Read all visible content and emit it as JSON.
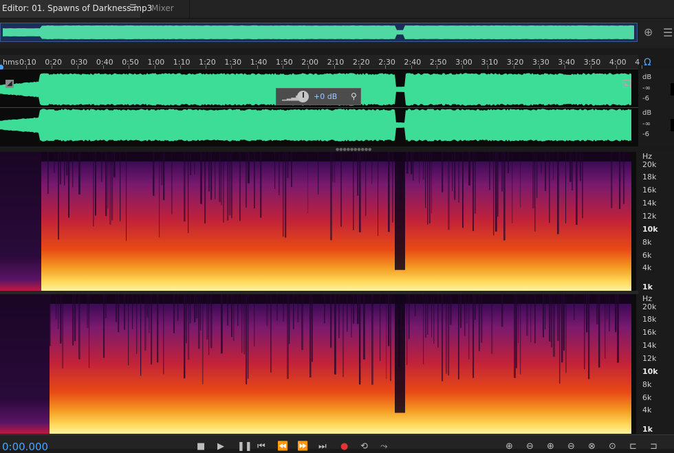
{
  "tabs": {
    "editor_label": "Editor: 01. Spawns of Darkness.mp3",
    "editor_menu_icon": "hamburger-icon",
    "mixer_label": "Mixer"
  },
  "ruler": {
    "unit_label": "hms",
    "ticks": [
      "0:10",
      "0:20",
      "0:30",
      "0:40",
      "0:50",
      "1:00",
      "1:10",
      "1:20",
      "1:30",
      "1:40",
      "1:50",
      "2:00",
      "2:10",
      "2:20",
      "2:30",
      "2:40",
      "2:50",
      "3:00",
      "3:10",
      "3:20",
      "3:30",
      "3:40",
      "3:50",
      "4:00",
      "4"
    ]
  },
  "waveform": {
    "db_unit": "dB",
    "db_inf": "-∞",
    "db_minus6": "-6",
    "wave_color": "#3ddc97"
  },
  "hud": {
    "gain_value": "+0 dB",
    "pin_icon": "pin-icon",
    "knob_icon": "volume-knob-icon"
  },
  "spectral": {
    "unit": "Hz",
    "labels": [
      "20k",
      "18k",
      "16k",
      "14k",
      "12k",
      "10k",
      "8k",
      "6k",
      "4k",
      "1k"
    ]
  },
  "transport": {
    "timecode": "0:00.000",
    "buttons": [
      "stop-icon",
      "play-icon",
      "pause-icon",
      "skip-to-start-icon",
      "rewind-icon",
      "fast-forward-icon",
      "skip-to-end-icon",
      "record-icon",
      "loop-icon",
      "skip-selection-icon"
    ]
  },
  "colors": {
    "accent": "#4aa3ff",
    "overview_bg": "#1c2f55"
  }
}
